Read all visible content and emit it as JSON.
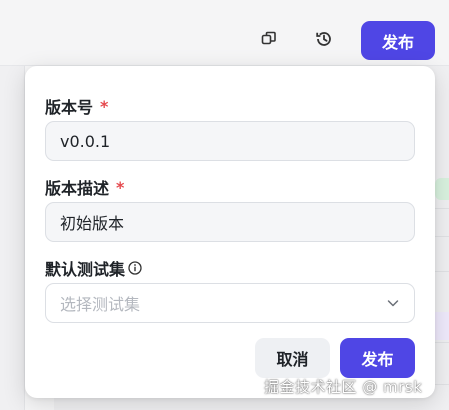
{
  "toolbar": {
    "copy_icon": "copy-icon",
    "history_icon": "history-icon",
    "publish_label": "发布"
  },
  "dialog": {
    "version_label": "版本号",
    "version_required": "*",
    "version_value": "v0.0.1",
    "desc_label": "版本描述",
    "desc_required": "*",
    "desc_value": "初始版本",
    "testset_label": "默认测试集",
    "testset_info_icon": "info-icon",
    "testset_placeholder": "选择测试集",
    "cancel_label": "取消",
    "publish_label": "发布"
  },
  "watermark": "掘金技术社区 @ mrsk",
  "colors": {
    "accent": "#4f46e5",
    "required": "#e5484d"
  }
}
